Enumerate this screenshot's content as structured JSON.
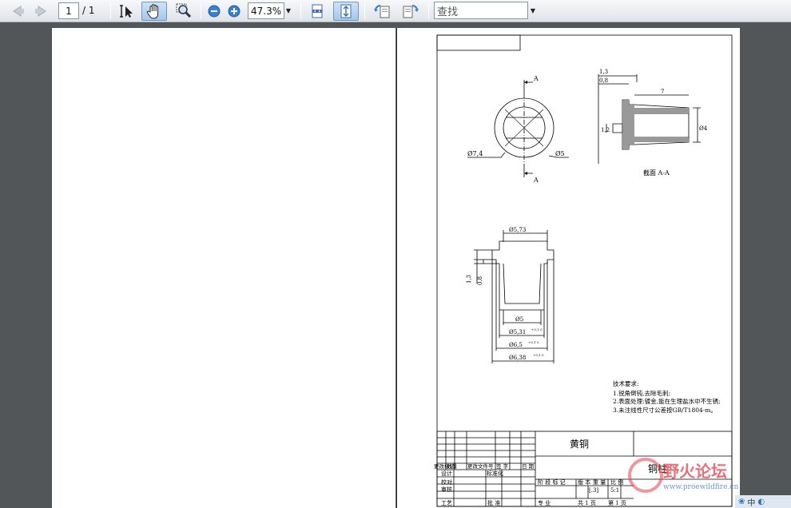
{
  "toolbar": {
    "page_current": "1",
    "page_total": "/ 1",
    "zoom": "47.3%",
    "search_placeholder": "查找"
  },
  "drawing": {
    "dim_top_view_dia_outer": "Ø7,4",
    "dim_top_view_dia_inner": "Ø5",
    "section_mark_a": "A",
    "section_dims": {
      "d1": "1,3",
      "d2": "0,8",
      "len": "7",
      "h": "1,2",
      "dia": "Ø4"
    },
    "section_label": "截面   A-A",
    "front_view": {
      "dia_top": "Ø5,73",
      "left_13": "1,3",
      "left_08": "0,8",
      "dia_5": "Ø5",
      "dia_531": "Ø5,31",
      "dia_531_tol": "+0,1 0",
      "dia_65": "Ø6,5",
      "dia_65_tol": "+0,1 0",
      "dia_638": "Ø6,38",
      "dia_638_tol": "+0,1 0"
    },
    "tech_req": {
      "title": "技术要求:",
      "line1": "1.锐角倒钝,去除毛刺;",
      "line2": "2.表面处理:镀金,能在生理盐水中不生锈;",
      "line3": "3.未注线性尺寸公差按GB/T1804-m。"
    },
    "title_block": {
      "material": "黄铜",
      "part_name": "铜柱",
      "header_cells": [
        "更改标记",
        "数量",
        "更改文件号",
        "签 字",
        "日 期"
      ],
      "row_design": "设计",
      "row_std": "标准化",
      "row_check": "校对",
      "row_review": "审核",
      "row_process": "工艺",
      "row_approve": "批 准",
      "stage_label": "阶 段 标 记",
      "version_label": "版 本",
      "weight_label": "重 量",
      "scale_label": "比 例",
      "version_value": "[.3]",
      "scale_value": "5:1",
      "specialty": "专 业",
      "total_pages": "共 1 页",
      "page_no": "第 1 页"
    }
  },
  "watermark": {
    "text": "野火论坛",
    "url": "www.proewildfire.cn"
  },
  "tray": {
    "ime": "中"
  },
  "colors": {
    "toolbar_bg": "#e6e9ed",
    "viewport_bg": "#525659",
    "watermark": "#e0404a"
  }
}
